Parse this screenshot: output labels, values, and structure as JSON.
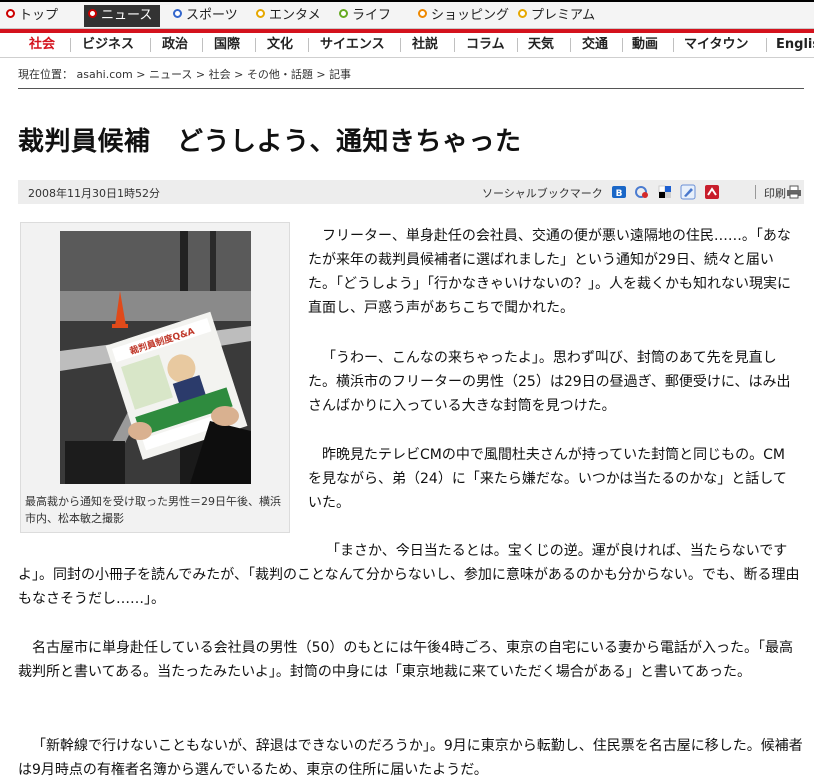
{
  "top_tabs": [
    {
      "label": "トップ",
      "color": "#cc0000"
    },
    {
      "label": "ニュース",
      "color": "#cc0000"
    },
    {
      "label": "スポーツ",
      "color": "#3366cc"
    },
    {
      "label": "エンタメ",
      "color": "#e6a800"
    },
    {
      "label": "ライフ",
      "color": "#66aa22"
    },
    {
      "label": "ショッピング",
      "color": "#ee8800"
    },
    {
      "label": "プレミアム",
      "color": "#e6a800"
    }
  ],
  "categories": [
    "社会",
    "ビジネス",
    "政治",
    "国際",
    "文化",
    "サイエンス",
    "社説",
    "コラム",
    "天気",
    "交通",
    "動画",
    "マイタウン",
    "English"
  ],
  "breadcrumb": {
    "prefix": "現在位置：",
    "items": [
      "asahi.com",
      "ニュース",
      "社会",
      "その他・話題",
      "記事"
    ],
    "separator": ">"
  },
  "article": {
    "title": "裁判員候補　どうしよう、通知きちゃった",
    "date": "2008年11月30日1時52分",
    "social_label": "ソーシャルブックマーク",
    "print_label": "印刷",
    "photo_caption": "最高裁から通知を受け取った男性＝29日午後、横浜市内、松本敏之撮影",
    "paragraphs": [
      "フリーター、単身赴任の会社員、交通の便が悪い遠隔地の住民……。「あなたが来年の裁判員候補者に選ばれました」という通知が29日、続々と届いた。「どうしよう」「行かなきゃいけないの？」。人を裁くかも知れない現実に直面し、戸惑う声があちこちで聞かれた。",
      "「うわー、こんなの来ちゃったよ」。思わず叫び、封筒のあて先を見直した。横浜市のフリーターの男性（25）は29日の昼過ぎ、郵便受けに、はみ出さんばかりに入っている大きな封筒を見つけた。",
      "昨晩見たテレビCMの中で風間杜夫さんが持っていた封筒と同じもの。CMを見ながら、弟（24）に「来たら嫌だな。いつかは当たるのかな」と話していた。",
      "「まさか、今日当たるとは。宝くじの逆。運が良ければ、当たらないですよ」。同封の小冊子を読んでみたが、「裁判のことなんて分からないし、参加に意味があるのかも分からない。でも、断る理由もなさそうだし……」。",
      "名古屋市に単身赴任している会社員の男性（50）のもとには午後4時ごろ、東京の自宅にいる妻から電話が入った。「最高裁判所と書いてある。当たったみたいよ」。封筒の中身には「東京地裁に来ていただく場合がある」と書いてあった。",
      "「新幹線で行けないこともないが、辞退はできないのだろうか」。9月に東京から転勤し、住民票を名古屋に移した。候補者は9月時点の有権者名簿から選んでいるため、東京の住所に届いたようだ。"
    ],
    "booklet_text": "裁判員制度Q&A"
  },
  "icons": {
    "social": [
      "hatena-bookmark-icon",
      "livedoor-clip-icon",
      "delicious-icon",
      "buzzurl-icon",
      "newsing-icon"
    ],
    "print": "printer-icon"
  }
}
